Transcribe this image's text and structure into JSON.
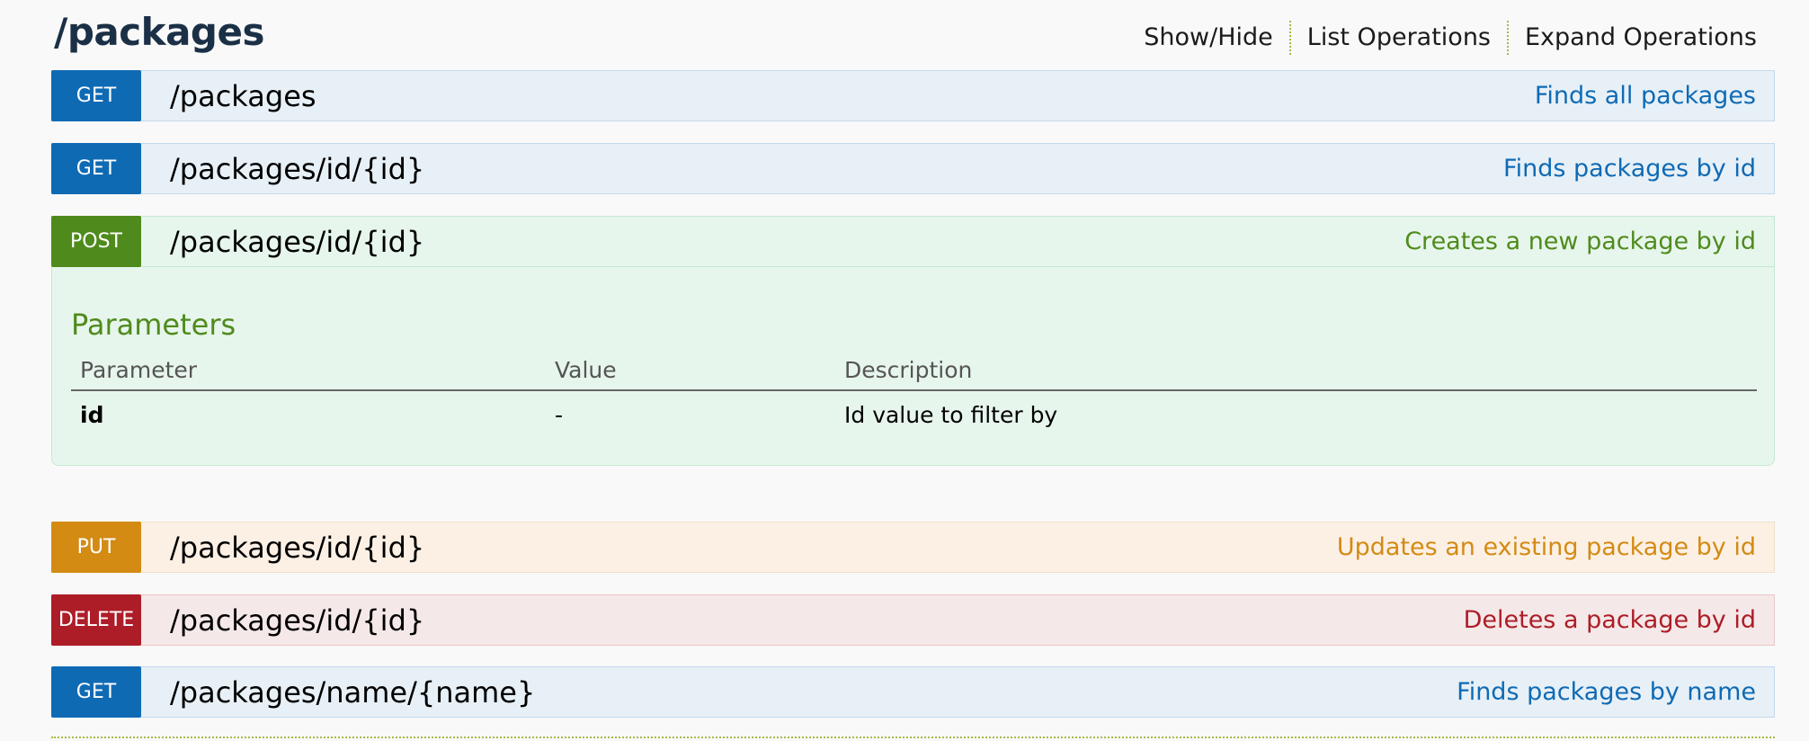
{
  "resource": {
    "title": "/packages",
    "actions": [
      "Show/Hide",
      "List Operations",
      "Expand Operations"
    ]
  },
  "operations": [
    {
      "method": "GET",
      "path": "/packages",
      "summary": "Finds all packages"
    },
    {
      "method": "GET",
      "path": "/packages/id/{id}",
      "summary": "Finds packages by id"
    },
    {
      "method": "POST",
      "path": "/packages/id/{id}",
      "summary": "Creates a new package by id"
    },
    {
      "method": "PUT",
      "path": "/packages/id/{id}",
      "summary": "Updates an existing package by id"
    },
    {
      "method": "DELETE",
      "path": "/packages/id/{id}",
      "summary": "Deletes a package by id"
    },
    {
      "method": "GET",
      "path": "/packages/name/{name}",
      "summary": "Finds packages by name"
    }
  ],
  "expanded": {
    "heading": "Parameters",
    "columns": [
      "Parameter",
      "Value",
      "Description"
    ],
    "rows": [
      {
        "parameter": "id",
        "value": "-",
        "description": "Id value to filter by"
      }
    ]
  },
  "colors": {
    "get": "#0f6ab4",
    "post": "#4f8b1c",
    "put": "#d38b14",
    "delete": "#ad1d28"
  }
}
